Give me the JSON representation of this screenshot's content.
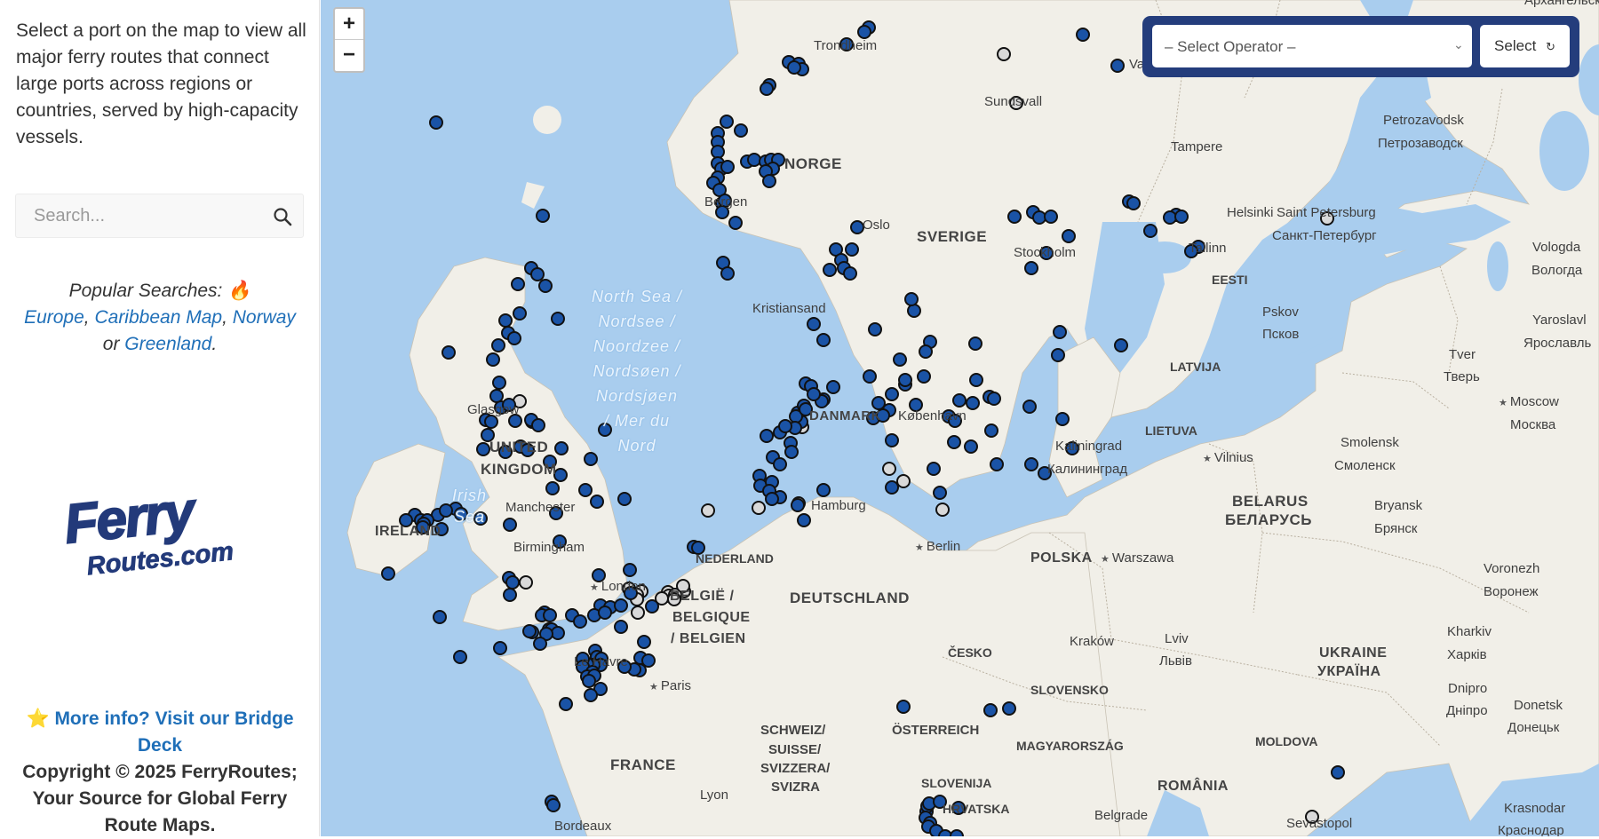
{
  "sidebar": {
    "intro": "Select a port on the map to view all major ferry routes that connect large ports across regions or countries, served by high-capacity vessels.",
    "search_placeholder": "Search...",
    "search_icon": "search-icon",
    "popular_prefix": "Popular Searches: 🔥",
    "popular_links": [
      "Europe",
      "Caribbean Map",
      "Norway",
      "Greenland"
    ],
    "popular_sep1": ", ",
    "popular_sep2": ", ",
    "popular_or": " or ",
    "popular_end": ".",
    "logo_line1": "Ferry",
    "logo_line2": "Routes.com",
    "footer_star": "⭐",
    "footer_link": "More info? Visit our Bridge Deck",
    "footer_copyright": "Copyright © 2025 FerryRoutes; Your Source for Global Ferry Route Maps."
  },
  "map": {
    "zoom_in": "+",
    "zoom_out": "−",
    "operator_placeholder": "– Select Operator –",
    "operator_button": "Select",
    "operator_button_icon": "refresh-icon",
    "labels": {
      "trondheim": "Trondheim",
      "vaasa": "Vaasa",
      "sundsvall": "Sundsvall",
      "arkhangelsk": "Архангельск",
      "petrozavodsk": "Petrozavodsk",
      "petrozavodsk_ru": "Петрозаводск",
      "tampere": "Tampere",
      "norge": "NORGE",
      "sverige": "SVERIGE",
      "bergen": "Bergen",
      "oslo": "Oslo",
      "helsinki": "Helsinki",
      "stpetersburg": "Saint Petersburg",
      "stpetersburg_ru": "Санкт-Петербург",
      "stockholm": "Stockholm",
      "tallinn": "Tallinn",
      "vologda": "Vologda",
      "vologda_ru": "Вологда",
      "eesti": "EESTI",
      "kristiansand": "Kristiansand",
      "pskov": "Pskov",
      "pskov_ru": "Псков",
      "yaroslavl": "Yaroslavl",
      "yaroslavl_ru": "Ярославль",
      "tver": "Tver",
      "tver_ru": "Тверь",
      "latvija": "LATVIJA",
      "moscow": "Moscow",
      "moscow_ru": "Москва",
      "danmark": "DANMARK",
      "kobenhavn": "København",
      "lietuva": "LIETUVA",
      "glasgow": "Glasgow",
      "uk1": "UNITED",
      "uk2": "KINGDOM",
      "kaliningrad": "Kaliningrad",
      "kaliningrad_ru": "Калининград",
      "vilnius": "Vilnius",
      "smolensk": "Smolensk",
      "smolensk_ru": "Смоленск",
      "manchester": "Manchester",
      "hamburg": "Hamburg",
      "belarus": "BELARUS",
      "belarus_ru": "БЕЛАРУСЬ",
      "bryansk": "Bryansk",
      "bryansk_ru": "Брянск",
      "ireland": "IRELAND",
      "birmingham": "Birmingham",
      "berlin": "Berlin",
      "polska": "POLSKA",
      "warszawa": "Warszawa",
      "nederland": "NEDERLAND",
      "voronezh": "Voronezh",
      "voronezh_ru": "Воронеж",
      "london": "London",
      "belgie1": "BELGIË /",
      "belgie2": "BELGIQUE",
      "belgie3": "/ BELGIEN",
      "deutschland": "DEUTSCHLAND",
      "kharkiv": "Kharkiv",
      "kharkiv_ru": "Харків",
      "cesko": "ČESKO",
      "krakow": "Kraków",
      "lviv": "Lviv",
      "lviv_ru": "Львів",
      "ukraine": "UKRAINE",
      "ukraine_ru": "УКРАЇНА",
      "lehavre": "Le Havre",
      "paris": "Paris",
      "slovensko": "SLOVENSKO",
      "dnipro": "Dnipro",
      "dnipro_ru": "Дніпро",
      "donetsk": "Donetsk",
      "donetsk_ru": "Донецьк",
      "schweiz1": "SCHWEIZ/",
      "schweiz2": "SUISSE/",
      "schweiz3": "SVIZZERA/",
      "schweiz4": "SVIZRA",
      "osterreich": "ÖSTERREICH",
      "magyar": "MAGYARORSZÁG",
      "moldova": "MOLDOVA",
      "france": "FRANCE",
      "slovenija": "SLOVENIJA",
      "hrvatska": "HRVATSKA",
      "romania": "ROMÂNIA",
      "lyon": "Lyon",
      "belgrade": "Belgrade",
      "krasnodar": "Krasnodar",
      "krasnodar_ru": "Краснодар",
      "bordeaux": "Bordeaux",
      "sevastopol": "Sevastopol",
      "north_sea": "North Sea /\nNordsee /\nNoordzee /\nNordsøen /\nNordsjøen\n/ Mer du\nNord",
      "irish_sea": "Irish\nSea"
    }
  },
  "colors": {
    "water": "#a9cdee",
    "land": "#f1efe8",
    "port_major": "#1a53a6",
    "port_minor": "#d9d9d9",
    "panel": "#243d7c",
    "link": "#1f6fb8"
  }
}
